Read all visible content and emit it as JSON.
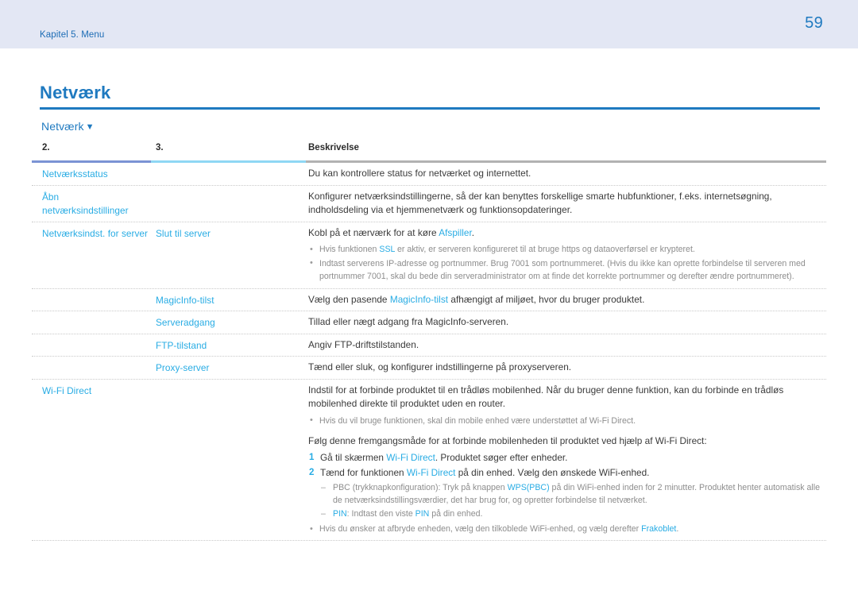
{
  "header": {
    "chapter": "Kapitel 5. Menu",
    "page_number": "59",
    "band_color": "#e3e7f4",
    "accent_color": "#1f7ac0"
  },
  "section": {
    "title": "Netværk",
    "sub_title": "Netværk",
    "sub_title_arrow": "▼",
    "link_color": "#28ace4"
  },
  "table": {
    "columns": [
      "2.",
      "3.",
      "Beskrivelse"
    ],
    "rows": [
      {
        "col1": "Netværksstatus",
        "col2": "",
        "desc": "Du kan kontrollere status for netværket og internettet."
      },
      {
        "col1": "Åbn netværksindstillinger",
        "col1_line1": "Åbn",
        "col1_line2": "netværksindstillinger",
        "col2": "",
        "desc": "Konfigurer netværksindstillingerne, så der kan benyttes forskellige smarte hubfunktioner, f.eks. internetsøgning, indholdsdeling via et hjemmenetværk og funktionsopdateringer."
      },
      {
        "col1": "Netværksindst. for server",
        "col2": "Slut til server",
        "desc_pre": "Kobl på et nærværk for at køre ",
        "desc_kw": "Afspiller",
        "desc_post": ".",
        "bullets": [
          {
            "pre": "Hvis funktionen ",
            "kw": "SSL",
            "post": " er aktiv, er serveren konfigureret til at bruge https og dataoverførsel er krypteret."
          },
          {
            "pre": "Indtast serverens IP-adresse og portnummer. Brug 7001 som portnummeret. (Hvis du ikke kan oprette forbindelse til serveren med portnummer 7001, skal du bede din serveradministrator om at finde det korrekte portnummer og derefter ændre portnummeret).",
            "kw": "",
            "post": ""
          }
        ]
      },
      {
        "col1": "",
        "col2": "MagicInfo-tilst",
        "desc_pre": "Vælg den pasende ",
        "desc_kw": "MagicInfo-tilst",
        "desc_post": " afhængigt af miljøet, hvor du bruger produktet."
      },
      {
        "col1": "",
        "col2": "Serveradgang",
        "desc": "Tillad eller nægt adgang fra MagicInfo-serveren."
      },
      {
        "col1": "",
        "col2": "FTP-tilstand",
        "desc": "Angiv FTP-driftstilstanden."
      },
      {
        "col1": "",
        "col2": "Proxy-server",
        "desc": "Tænd eller sluk, og konfigurer indstillingerne på proxyserveren."
      }
    ],
    "wifi_row": {
      "col1": "Wi-Fi Direct",
      "col2": "",
      "desc": "Indstil for at forbinde produktet til en trådløs mobilenhed. Når du bruger denne funktion, kan du forbinde en trådløs mobilenhed direkte til produktet uden en router.",
      "note_bullet": "Hvis du vil bruge funktionen, skal din mobile enhed være understøttet af Wi-Fi Direct.",
      "lead": "Følg denne fremgangsmåde for at forbinde mobilenheden til produktet ved hjælp af Wi-Fi Direct:",
      "steps": [
        {
          "num": "1",
          "pre": "Gå til skærmen ",
          "kw": "Wi-Fi Direct",
          "post": ". Produktet søger efter enheder."
        },
        {
          "num": "2",
          "pre": "Tænd for funktionen ",
          "kw": "Wi-Fi Direct",
          "post": " på din enhed. Vælg den ønskede WiFi-enhed."
        }
      ],
      "substeps": [
        {
          "pre": "PBC (trykknapkonfiguration): Tryk på knappen ",
          "kw": "WPS(PBC)",
          "post": " på din WiFi-enhed inden for 2 minutter. Produktet henter automatisk alle de netværksindstillingsværdier, det har brug for, og opretter forbindelse til netværket."
        },
        {
          "pre": "",
          "kw": "PIN",
          "mid": ": Indtast den viste ",
          "kw2": "PIN",
          "post": " på din enhed."
        }
      ],
      "tail_bullet": {
        "pre": "Hvis du ønsker at afbryde enheden, vælg den tilkoblede WiFi-enhed, og vælg derefter ",
        "kw": "Frakoblet",
        "post": "."
      }
    }
  }
}
